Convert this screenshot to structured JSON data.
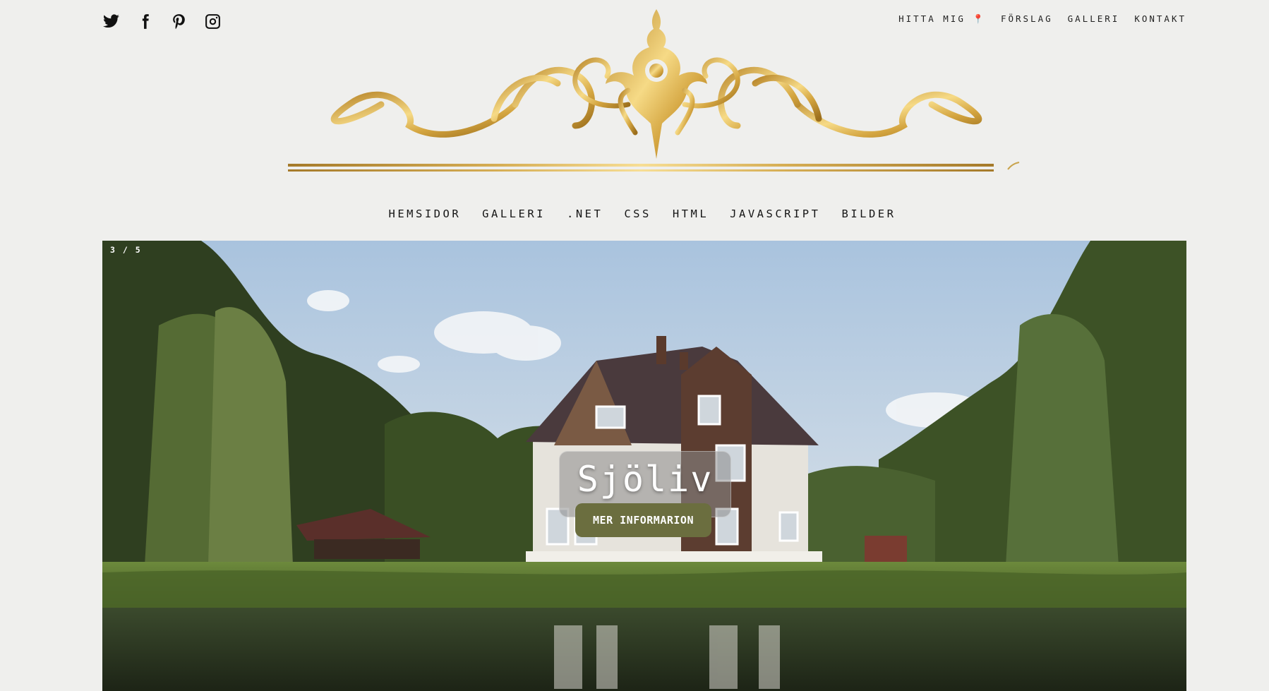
{
  "social": [
    {
      "icon": "twitter-icon"
    },
    {
      "icon": "facebook-icon"
    },
    {
      "icon": "pinterest-icon"
    },
    {
      "icon": "instagram-icon"
    }
  ],
  "top_nav": [
    "HITTA MIG 📍",
    "FÖRSLAG",
    "GALLERI",
    "KONTAKT"
  ],
  "main_nav": [
    "HEMSIDOR",
    "GALLERI",
    ".NET",
    "CSS",
    "HTML",
    "JAVASCRIPT",
    "BILDER"
  ],
  "hero": {
    "counter": "3 / 5",
    "title": "Sjöliv",
    "button_label": "MER INFORMARION"
  },
  "colors": {
    "background": "#efefed",
    "gold": "#d9b24a",
    "button": "#6b6e3f"
  }
}
